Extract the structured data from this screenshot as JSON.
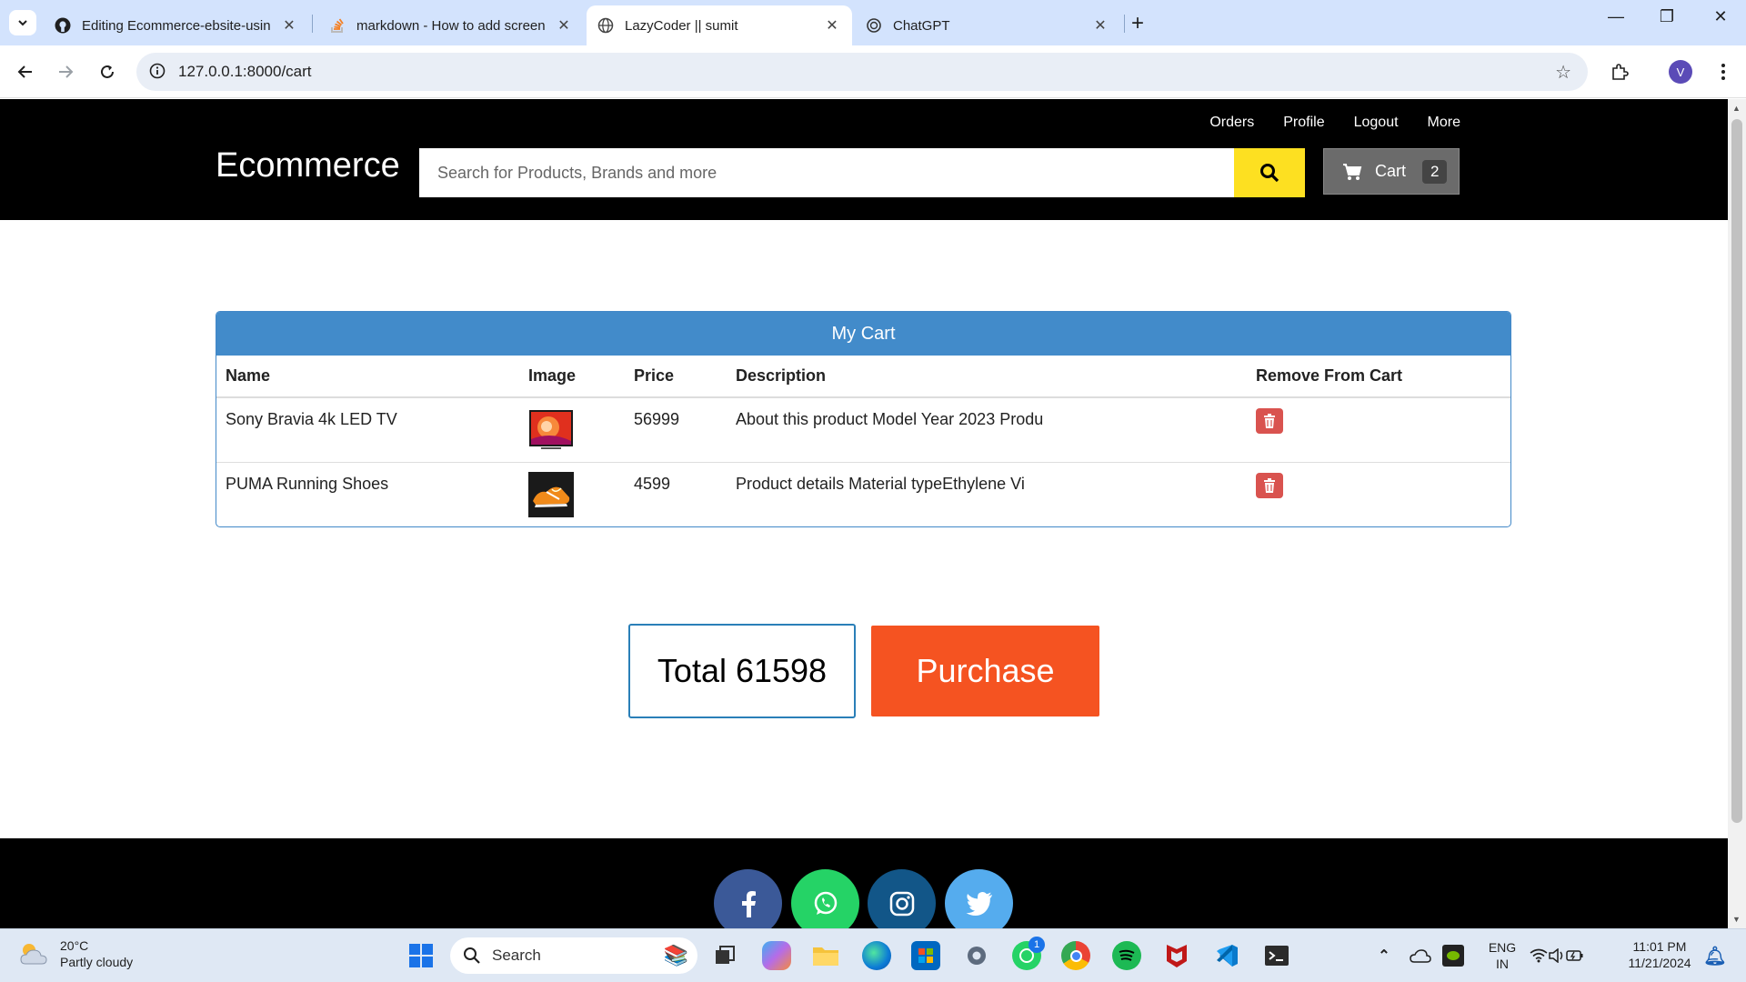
{
  "browser": {
    "tabs": [
      {
        "title": "Editing Ecommerce-ebsite-usin",
        "icon": "github-icon"
      },
      {
        "title": "markdown - How to add screen",
        "icon": "stackoverflow-icon"
      },
      {
        "title": "LazyCoder || sumit",
        "icon": "globe-icon",
        "active": true
      },
      {
        "title": "ChatGPT",
        "icon": "chatgpt-icon"
      }
    ],
    "url": "127.0.0.1:8000/cart",
    "profile_initial": "V"
  },
  "site": {
    "brand": "Ecommerce",
    "top_links": [
      "Orders",
      "Profile",
      "Logout",
      "More"
    ],
    "search_placeholder": "Search for Products, Brands and more",
    "cart_label": "Cart",
    "cart_count": "2"
  },
  "cart": {
    "heading": "My Cart",
    "columns": [
      "Name",
      "Image",
      "Price",
      "Description",
      "Remove From Cart"
    ],
    "rows": [
      {
        "name": "Sony Bravia 4k LED TV",
        "image": "tv-image",
        "price": "56999",
        "description": "About this product Model Year 2023 Produ"
      },
      {
        "name": "PUMA Running Shoes",
        "image": "shoe-image",
        "price": "4599",
        "description": "Product details Material typeEthylene Vi"
      }
    ],
    "total": "Total 61598",
    "purchase_label": "Purchase"
  },
  "footer": {
    "social": [
      "facebook-icon",
      "whatsapp-icon",
      "instagram-icon",
      "twitter-icon"
    ]
  },
  "taskbar": {
    "weather_temp": "20°C",
    "weather_desc": "Partly cloudy",
    "search_label": "Search",
    "whatsapp_badge": "1",
    "lang_top": "ENG",
    "lang_bottom": "IN",
    "time": "11:01 PM",
    "date": "11/21/2024"
  }
}
